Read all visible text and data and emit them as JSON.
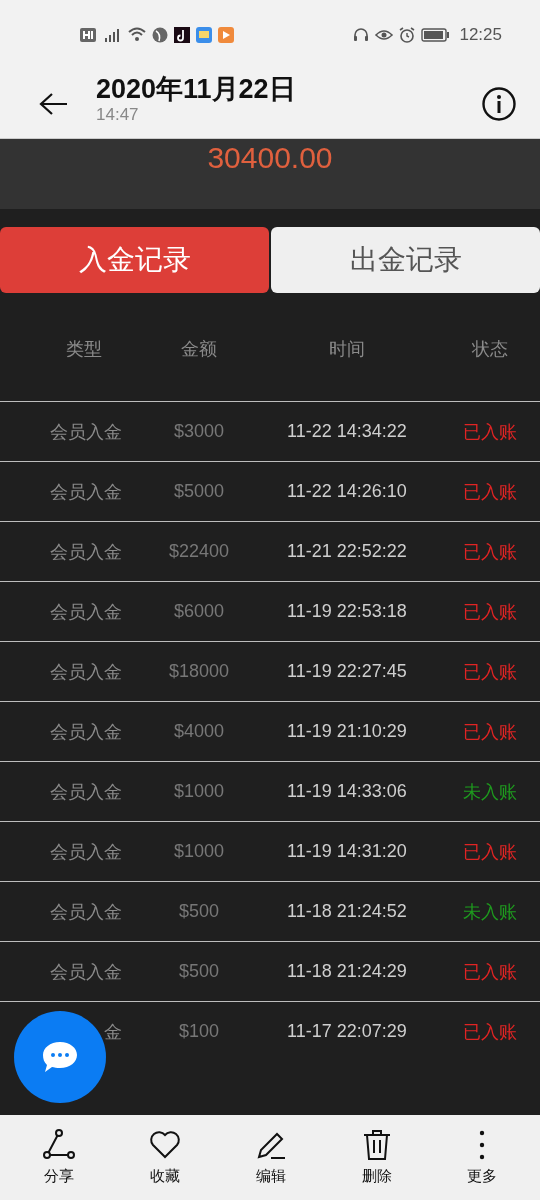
{
  "status_bar": {
    "time": "12:25"
  },
  "header": {
    "title": "2020年11月22日",
    "subtitle": "14:47"
  },
  "summary": {
    "amount": "30400.00"
  },
  "tabs": [
    {
      "label": "入金记录",
      "selected": true
    },
    {
      "label": "出金记录",
      "selected": false
    }
  ],
  "table": {
    "columns": [
      "类型",
      "金额",
      "时间",
      "状态"
    ],
    "rows": [
      {
        "type": "会员入金",
        "amount": "$3000",
        "time": "11-22 14:34:22",
        "status": "已入账",
        "credited": true
      },
      {
        "type": "会员入金",
        "amount": "$5000",
        "time": "11-22 14:26:10",
        "status": "已入账",
        "credited": true
      },
      {
        "type": "会员入金",
        "amount": "$22400",
        "time": "11-21 22:52:22",
        "status": "已入账",
        "credited": true
      },
      {
        "type": "会员入金",
        "amount": "$6000",
        "time": "11-19 22:53:18",
        "status": "已入账",
        "credited": true
      },
      {
        "type": "会员入金",
        "amount": "$18000",
        "time": "11-19 22:27:45",
        "status": "已入账",
        "credited": true
      },
      {
        "type": "会员入金",
        "amount": "$4000",
        "time": "11-19 21:10:29",
        "status": "已入账",
        "credited": true
      },
      {
        "type": "会员入金",
        "amount": "$1000",
        "time": "11-19 14:33:06",
        "status": "未入账",
        "credited": false
      },
      {
        "type": "会员入金",
        "amount": "$1000",
        "time": "11-19 14:31:20",
        "status": "已入账",
        "credited": true
      },
      {
        "type": "会员入金",
        "amount": "$500",
        "time": "11-18 21:24:52",
        "status": "未入账",
        "credited": false
      },
      {
        "type": "会员入金",
        "amount": "$500",
        "time": "11-18 21:24:29",
        "status": "已入账",
        "credited": true
      },
      {
        "type": "金",
        "amount": "$100",
        "time": "11-17 22:07:29",
        "status": "已入账",
        "credited": true
      }
    ]
  },
  "bottom_bar": [
    {
      "label": "分享",
      "kind": "share"
    },
    {
      "label": "收藏",
      "kind": "favorite"
    },
    {
      "label": "编辑",
      "kind": "edit"
    },
    {
      "label": "删除",
      "kind": "delete"
    },
    {
      "label": "更多",
      "kind": "more"
    }
  ]
}
